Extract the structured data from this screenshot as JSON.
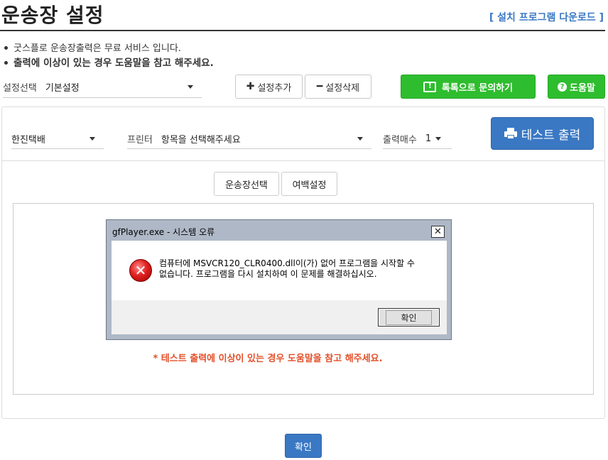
{
  "header": {
    "title": "운송장 설정",
    "download_link": "[ 설치 프로그램 다운로드 ]"
  },
  "notices": [
    "굿스플로 운송장출력은 무료 서비스 입니다.",
    "출력에 이상이 있는 경우 도움말을 참고 해주세요."
  ],
  "toolbar": {
    "setting_label": "설정선택",
    "setting_value": "기본설정",
    "add_label": "설정추가",
    "delete_label": "설정삭제",
    "talk_label": "톡톡으로 문의하기",
    "help_label": "도움말",
    "colors": {
      "green": "#2ebd2e"
    }
  },
  "print_options": {
    "courier_value": "한진택배",
    "printer_label": "프린터",
    "printer_value": "항목을 선택해주세요",
    "copies_label": "출력매수",
    "copies_value": "1",
    "test_print_label": "테스트 출력",
    "colors": {
      "blue": "#3a78c4"
    }
  },
  "tabs": [
    {
      "label": "운송장선택"
    },
    {
      "label": "여백설정"
    }
  ],
  "warning": "* 테스트 출력에 이상이 있는 경우 도움말을 참고 해주세요.",
  "confirm_label": "확인",
  "dialog": {
    "title": "gfPlayer.exe - 시스템 오류",
    "close_glyph": "✕",
    "message_line1": "컴퓨터에 MSVCR120_CLR0400.dll이(가) 없어 프로그램을 시작할 수",
    "message_line2": "없습니다. 프로그램을 다시 설치하여 이 문제를 해결하십시오.",
    "ok_label": "확인",
    "icon": "error-icon"
  }
}
